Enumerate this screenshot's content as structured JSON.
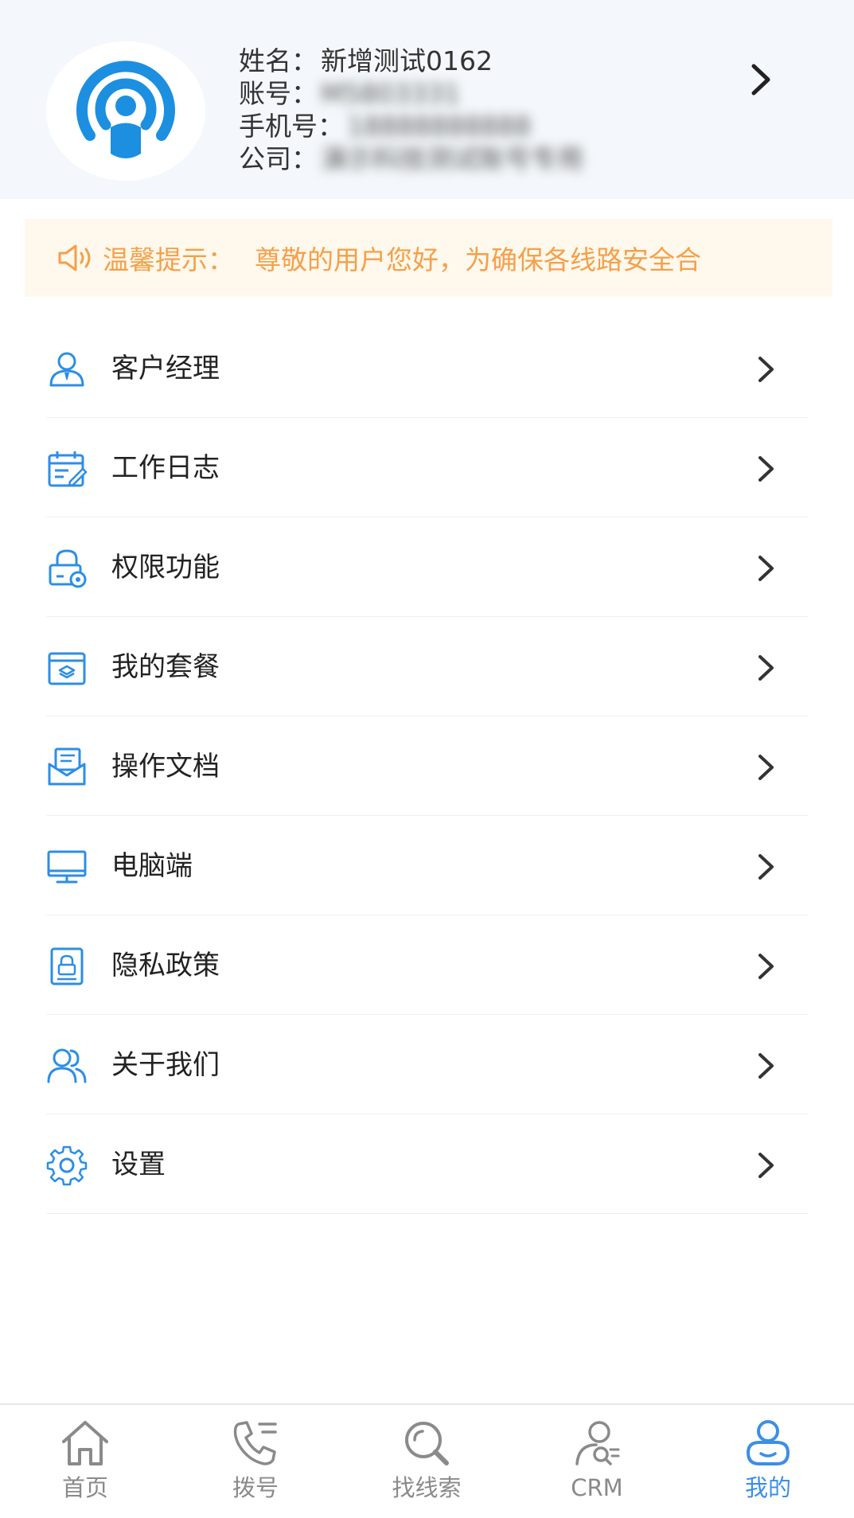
{
  "colors": {
    "accent": "#3b8fe6",
    "avatar_blue": "#1c8fe0",
    "notice_text": "#f5a04a",
    "notice_bg": "#fff8ec",
    "header_bg": "#f4f8fc",
    "tab_inactive": "#8a8a8a"
  },
  "profile": {
    "name_label": "姓名：",
    "name_value": "新增测试0162",
    "account_label": "账号：",
    "account_value": "M5803331",
    "phone_label": "手机号：",
    "phone_value": "18888888888",
    "company_label": "公司：",
    "company_value": "演示科技测试账号专用",
    "avatar_icon": "broadcast-user-icon",
    "chevron_icon": "chevron-right-icon"
  },
  "notice": {
    "icon": "speaker-icon",
    "title": "温馨提示：",
    "text": "尊敬的用户您好，为确保各线路安全合"
  },
  "menu": {
    "items": [
      {
        "label": "客户经理",
        "icon": "manager-icon"
      },
      {
        "label": "工作日志",
        "icon": "calendar-edit-icon"
      },
      {
        "label": "权限功能",
        "icon": "lock-gear-icon"
      },
      {
        "label": "我的套餐",
        "icon": "package-icon"
      },
      {
        "label": "操作文档",
        "icon": "document-icon"
      },
      {
        "label": "电脑端",
        "icon": "monitor-icon"
      },
      {
        "label": "隐私政策",
        "icon": "privacy-icon"
      },
      {
        "label": "关于我们",
        "icon": "users-icon"
      },
      {
        "label": "设置",
        "icon": "gear-icon"
      }
    ]
  },
  "tabbar": {
    "tabs": [
      {
        "label": "首页",
        "icon": "home-icon",
        "active": false
      },
      {
        "label": "拨号",
        "icon": "phone-icon",
        "active": false
      },
      {
        "label": "找线索",
        "icon": "search-icon",
        "active": false
      },
      {
        "label": "CRM",
        "icon": "crm-icon",
        "active": false
      },
      {
        "label": "我的",
        "icon": "profile-icon",
        "active": true
      }
    ]
  }
}
